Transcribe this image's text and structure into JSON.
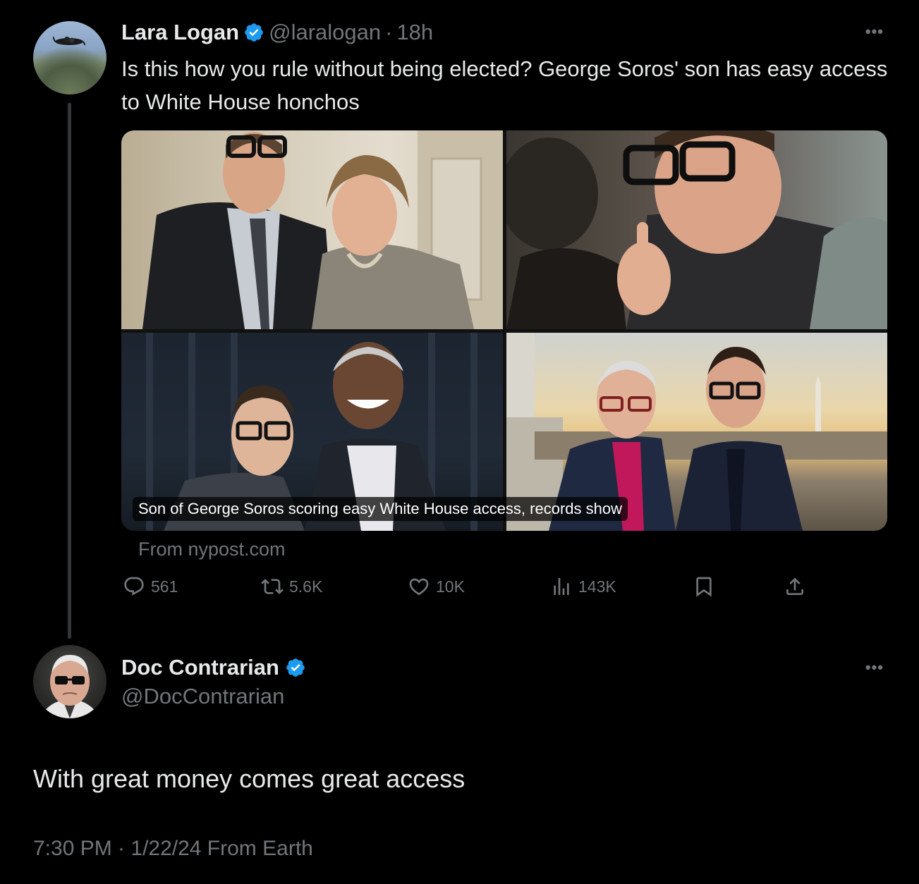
{
  "colors": {
    "background": "#000000",
    "text_primary": "#e7e9ea",
    "text_secondary": "#71767b",
    "verified_blue": "#1d9bf0",
    "thread_line": "#333639"
  },
  "original_tweet": {
    "author": {
      "display_name": "Lara Logan",
      "handle": "@laralogan",
      "verified": true,
      "avatar_icon": "skydiver-avatar"
    },
    "separator": "·",
    "time": "18h",
    "more_icon": "more-horizontal-icon",
    "more_label": "•••",
    "text": "Is this how you rule without being elected? George Soros' son has easy access to White House honchos",
    "link_card": {
      "headline": "Son of George Soros scoring easy White House access, records show",
      "source": "From nypost.com"
    },
    "actions": {
      "reply": {
        "icon": "reply-icon",
        "count": "561"
      },
      "retweet": {
        "icon": "retweet-icon",
        "count": "5.6K"
      },
      "like": {
        "icon": "heart-icon",
        "count": "10K"
      },
      "views": {
        "icon": "views-icon",
        "count": "143K"
      },
      "bookmark": {
        "icon": "bookmark-icon"
      },
      "share": {
        "icon": "share-icon"
      }
    }
  },
  "reply_tweet": {
    "author": {
      "display_name": "Doc Contrarian",
      "handle": "@DocContrarian",
      "verified": true,
      "avatar_icon": "portrait-avatar"
    },
    "more_label": "•••",
    "text": "With great money comes great access",
    "meta": "7:30 PM · 1/22/24 From Earth"
  }
}
